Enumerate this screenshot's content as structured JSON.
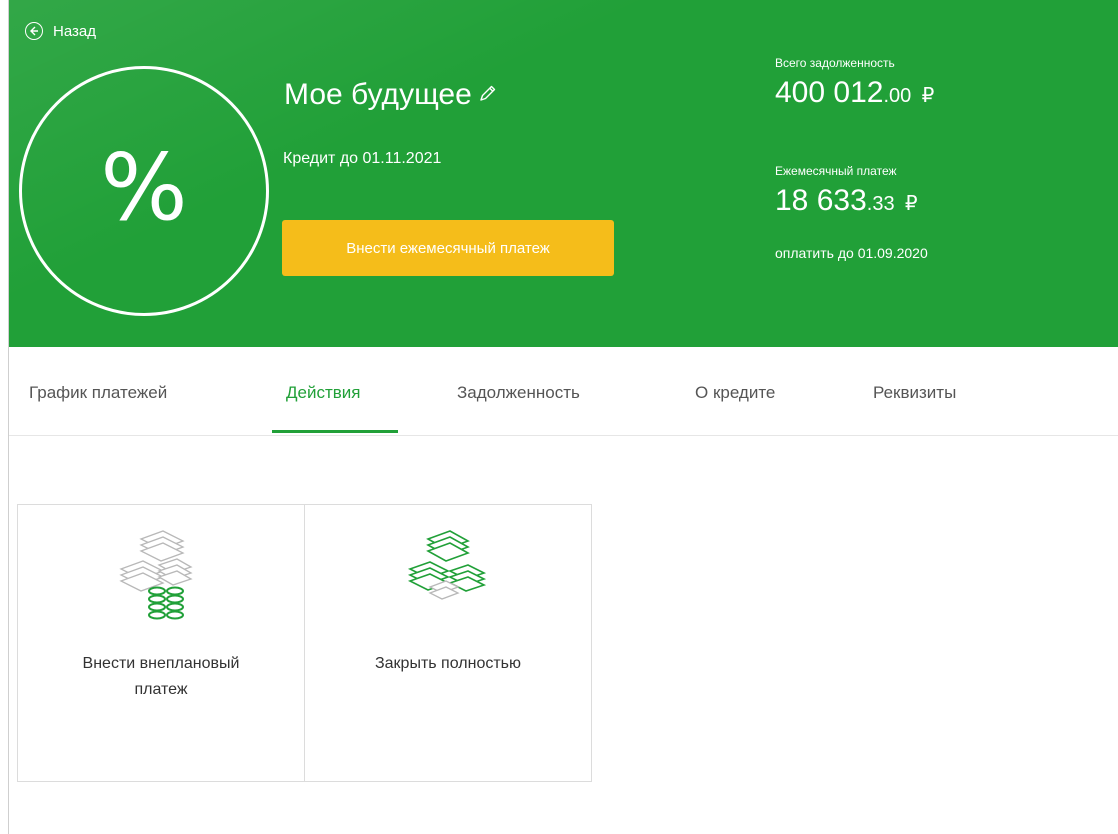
{
  "header": {
    "back_label": "Назад",
    "percent_symbol": "%",
    "loan_title": "Мое будущее",
    "loan_subtitle": "Кредит до 01.11.2021",
    "pay_button_label": "Внести ежемесячный платеж",
    "total_debt_label": "Всего задолженность",
    "total_debt_main": "400 012",
    "total_debt_cents": ".00",
    "currency": "₽",
    "monthly_payment_label": "Ежемесячный платеж",
    "monthly_payment_main": "18 633",
    "monthly_payment_cents": ".33",
    "due_text": "оплатить до 01.09.2020"
  },
  "tabs": [
    {
      "label": "График платежей",
      "active": false
    },
    {
      "label": "Действия",
      "active": true
    },
    {
      "label": "Задолженность",
      "active": false
    },
    {
      "label": "О кредите",
      "active": false
    },
    {
      "label": "Реквизиты",
      "active": false
    }
  ],
  "cards": [
    {
      "label_line1": "Внести внеплановый",
      "label_line2": "платеж",
      "icon": "money-coins-icon"
    },
    {
      "label_line1": "Закрыть полностью",
      "label_line2": "",
      "icon": "money-stacks-icon"
    }
  ],
  "colors": {
    "brand_green": "#21a038",
    "button_yellow": "#f5bd1a"
  }
}
